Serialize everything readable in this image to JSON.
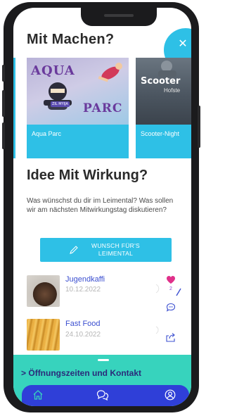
{
  "sections": {
    "mitmachen_title": "Mit Machen?",
    "idee_title": "Idee Mit Wirkung?",
    "idee_text": "Was wünschst du dir im Leimental? Was sollen wir am nächsten Mitwirkungstag diskutieren?"
  },
  "cards": [
    {
      "label": "Aqua Parc",
      "art_word_1": "AQUA",
      "art_word_2": "PARC",
      "badge": "ZIL MYIJA"
    },
    {
      "label": "Scooter-Night",
      "art_word_1": "Scooter",
      "art_word_2": "Hofste"
    }
  ],
  "wish_button": {
    "line1": "WUNSCH FÜR'S",
    "line2": "LEIMENTAL"
  },
  "items": [
    {
      "title": "Jugendkaffi",
      "date": "10.12.2022",
      "likes": "2"
    },
    {
      "title": "Fast Food",
      "date": "24.10.2022"
    }
  ],
  "bottom": {
    "hours_label": "Öffnungszeiten und Kontakt",
    "chevron": ">"
  },
  "colors": {
    "accent": "#2ec0e6",
    "navbar": "#2f3fd8",
    "sheet": "#37d3bd",
    "link": "#3b4fd0",
    "heart": "#e0308a"
  },
  "icons": [
    "close-icon",
    "pencil-icon",
    "heart-icon",
    "share-icon",
    "comment-icon",
    "export-icon",
    "home-icon",
    "chat-icon",
    "profile-icon"
  ]
}
